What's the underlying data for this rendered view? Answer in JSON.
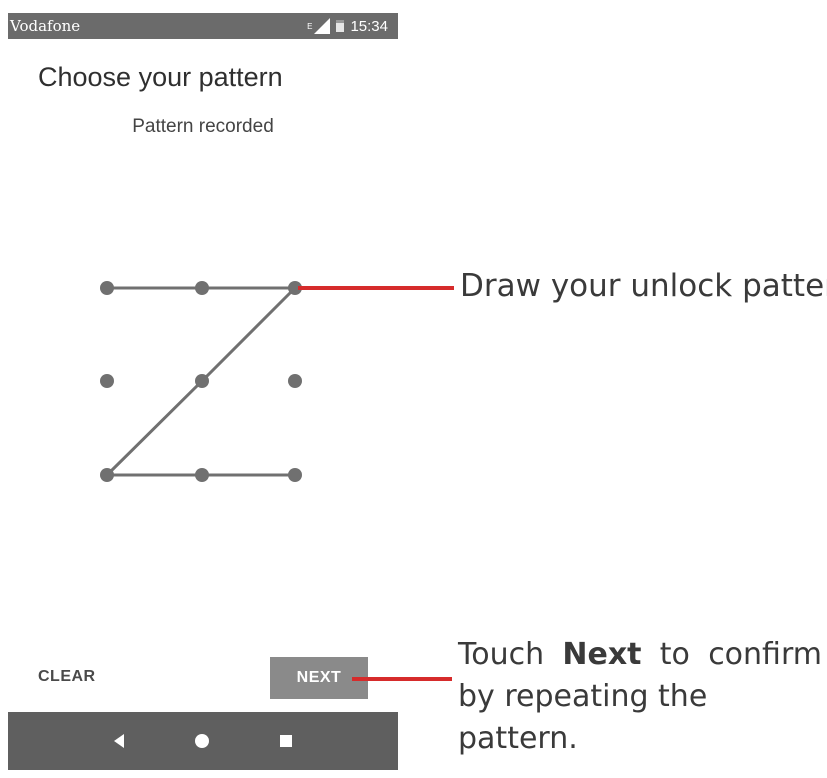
{
  "status_bar": {
    "carrier": "Vodafone",
    "network": "E",
    "time": "15:34"
  },
  "screen": {
    "title": "Choose your pattern",
    "subtitle": "Pattern recorded",
    "pattern_sequence": [
      1,
      2,
      3,
      5,
      7,
      8,
      9
    ]
  },
  "buttons": {
    "clear_label": "CLEAR",
    "next_label": "NEXT"
  },
  "nav_bar": {
    "icons": [
      "back-icon",
      "home-icon",
      "recents-icon"
    ]
  },
  "callouts": {
    "draw": {
      "text": "Draw your unlock pattern"
    },
    "next": {
      "prefix": "Touch",
      "bold_word": "Next",
      "mid": "to",
      "end": "confirm",
      "line2": "by repeating the pattern."
    }
  },
  "colors": {
    "callout_line": "#d62b2b",
    "pattern": "#707070",
    "bars": "#5f5f5f"
  }
}
